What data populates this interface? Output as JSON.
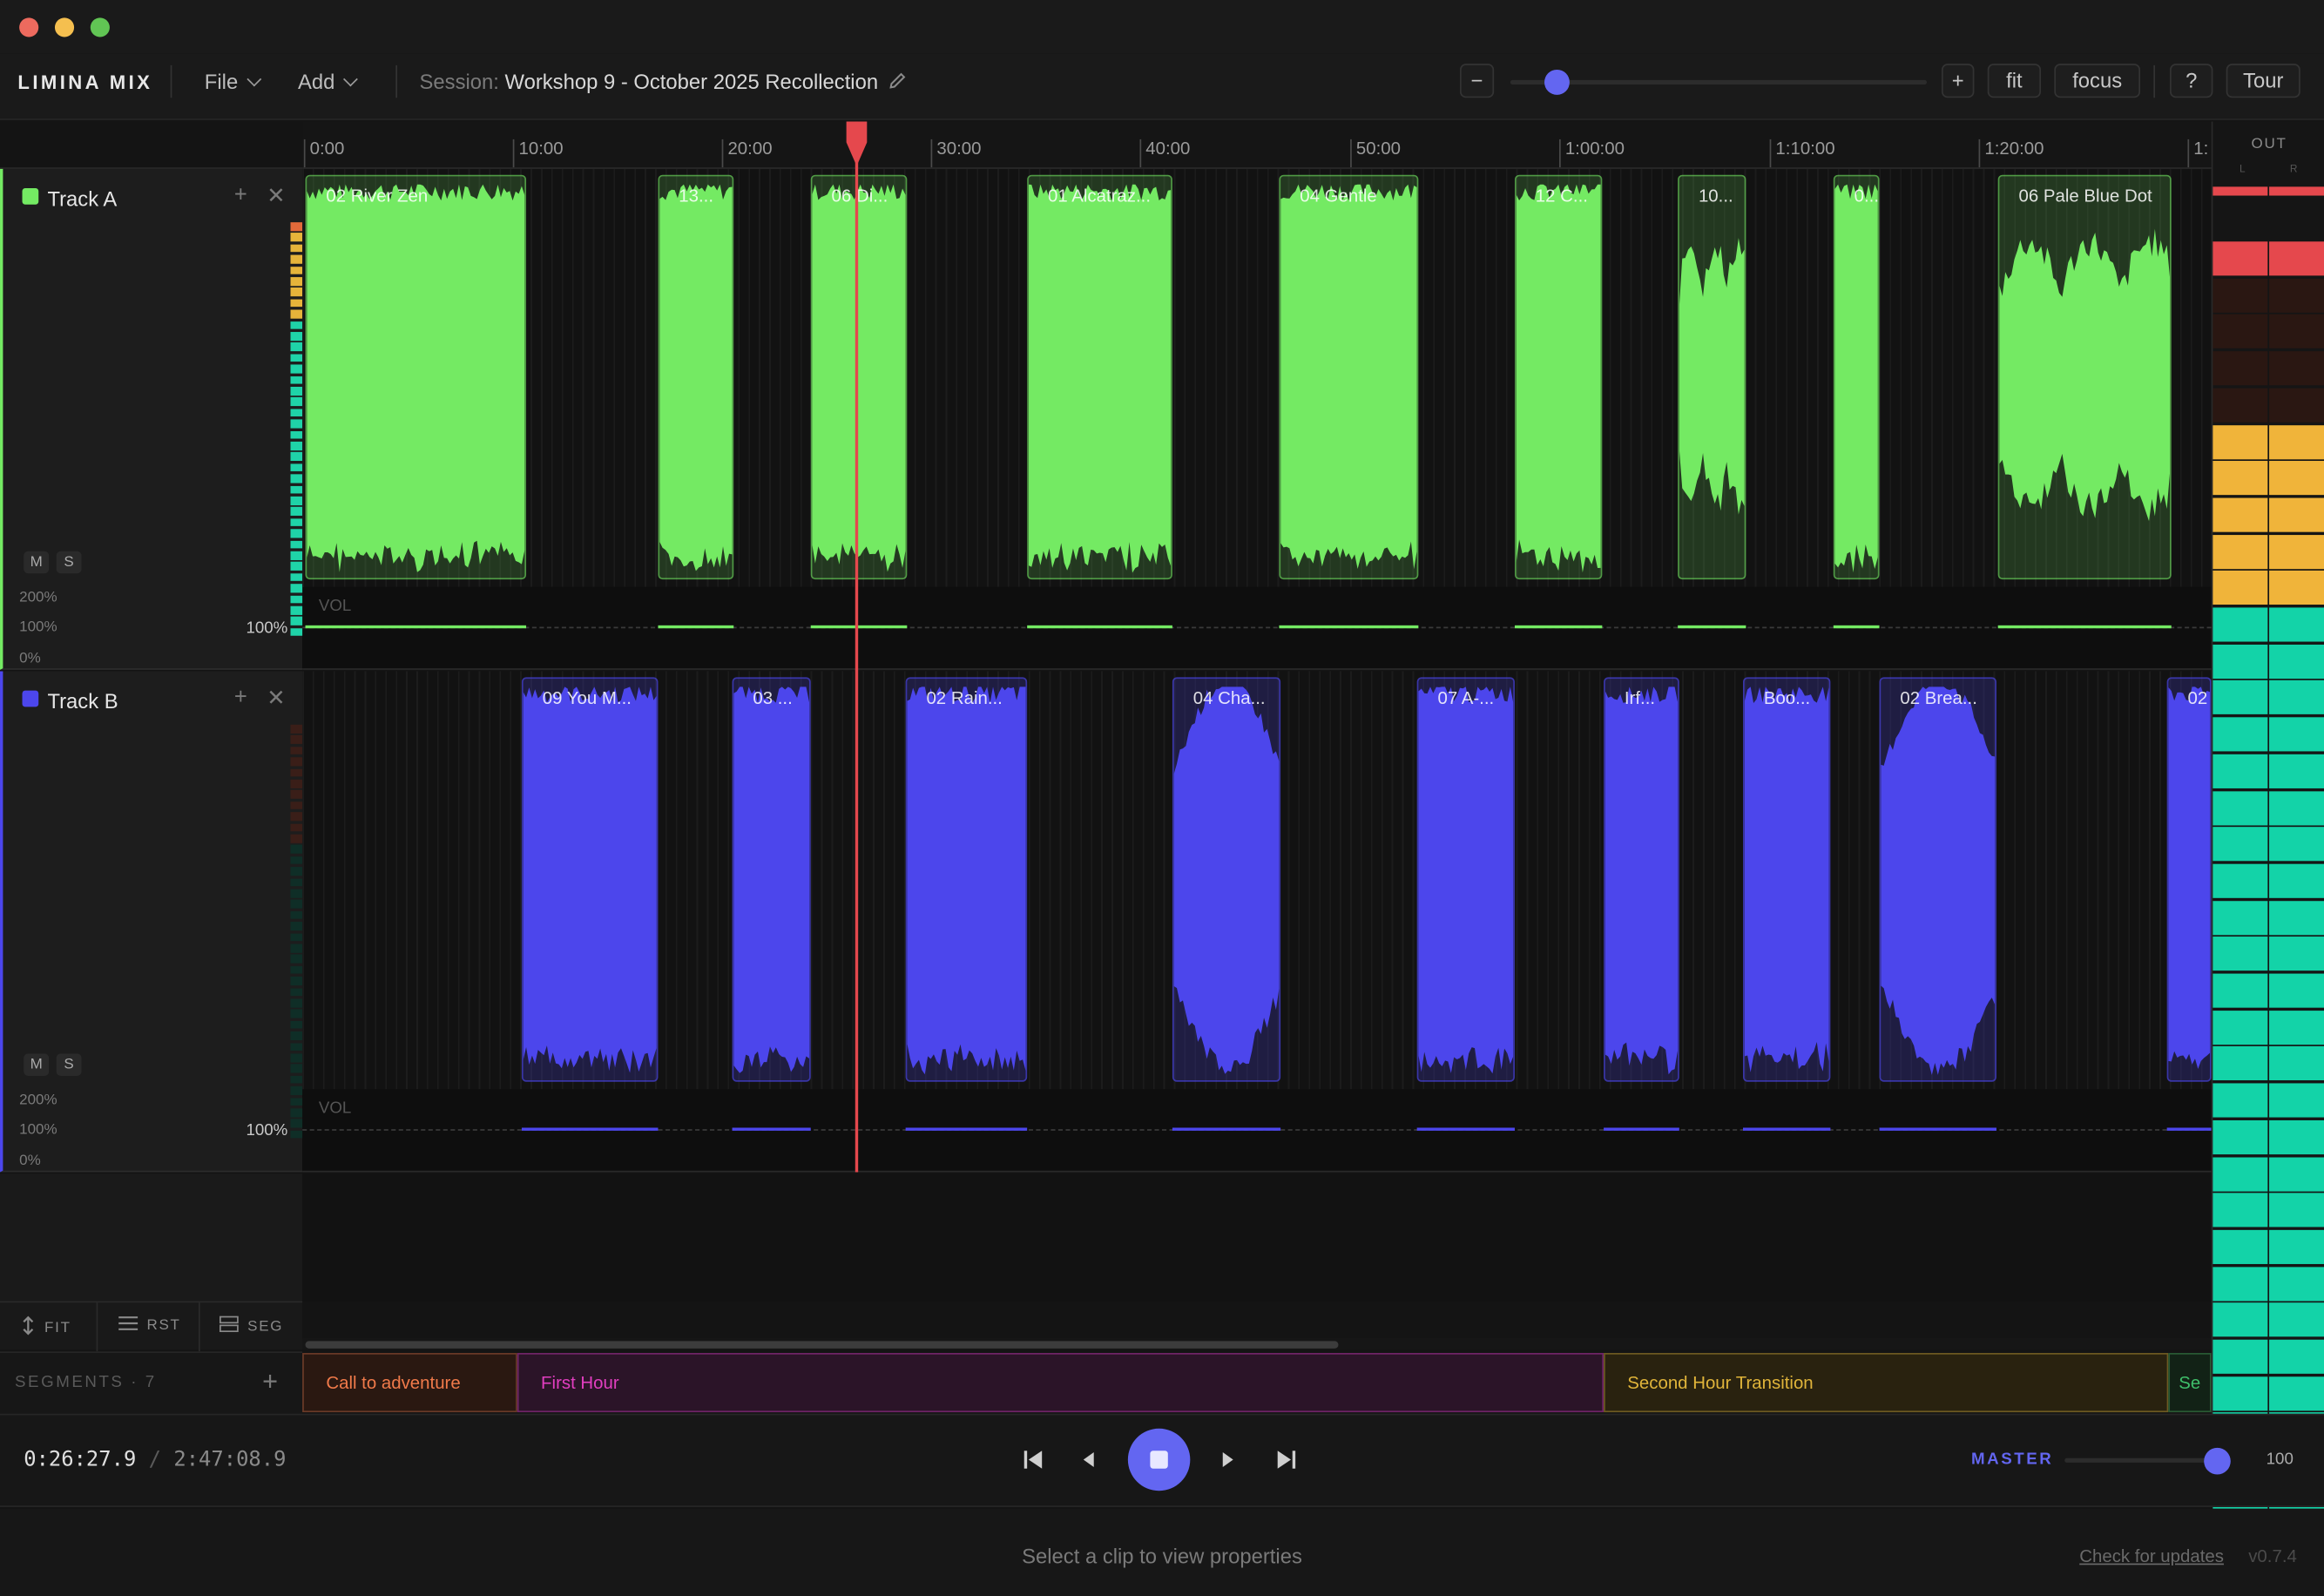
{
  "window": {
    "controls": [
      "close",
      "minimize",
      "zoom"
    ]
  },
  "toolbar": {
    "brand": "LIMINA MIX",
    "file_menu": "File",
    "add_menu": "Add",
    "session_label": "Session:",
    "session_name": "Workshop 9 - October 2025 Recollection",
    "zoom_out": "−",
    "zoom_in": "+",
    "zoom_level": 0.12,
    "fit": "fit",
    "focus": "focus",
    "help": "?",
    "tour": "Tour"
  },
  "ruler": {
    "labels": [
      "0:00",
      "10:00",
      "20:00",
      "30:00",
      "40:00",
      "50:00",
      "1:00:00",
      "1:10:00",
      "1:20:00",
      "1:"
    ]
  },
  "playhead": {
    "time": "0:26:27.9"
  },
  "tracks": [
    {
      "name": "Track A",
      "color": "#74ea63",
      "mute": "M",
      "solo": "S",
      "pct_high": "200%",
      "pct_mid": "100%",
      "pct_low": "0%",
      "volume": "100%",
      "vol_label": "VOL",
      "clips": [
        "02 River Zen",
        "13...",
        "06 Di...",
        "01 Alcatraz...",
        "04 Gentle",
        "12 C...",
        "10...",
        "0...",
        "06 Pale Blue Dot"
      ]
    },
    {
      "name": "Track B",
      "color": "#4c46ec",
      "mute": "M",
      "solo": "S",
      "pct_high": "200%",
      "pct_mid": "100%",
      "pct_low": "0%",
      "volume": "100%",
      "vol_label": "VOL",
      "clips": [
        "09 You M...",
        "03 ...",
        "02 Rain...",
        "04 Cha...",
        "07 A-...",
        "Irf...",
        "Boo...",
        "02 Brea...",
        "02"
      ]
    }
  ],
  "lane_tools": {
    "fit": "FIT",
    "reset": "RST",
    "seg": "SEG"
  },
  "segments": {
    "header": "SEGMENTS · 7",
    "add": "+",
    "items": [
      {
        "label": "Call to adventure",
        "color": "#f07a4a"
      },
      {
        "label": "First Hour",
        "color": "#e23ec0"
      },
      {
        "label": "Second Hour Transition",
        "color": "#e0b43a"
      },
      {
        "label": "Se",
        "color": "#3fbf6a"
      }
    ]
  },
  "output": {
    "title": "OUT",
    "left": "L",
    "right": "R"
  },
  "transport": {
    "current_time": "0:26:27.9",
    "separator": "/",
    "total_time": "2:47:08.9",
    "master_label": "MASTER",
    "master_value": "100"
  },
  "status": {
    "message": "Select a clip to view properties",
    "update_link": "Check for updates",
    "version": "v0.7.4"
  }
}
